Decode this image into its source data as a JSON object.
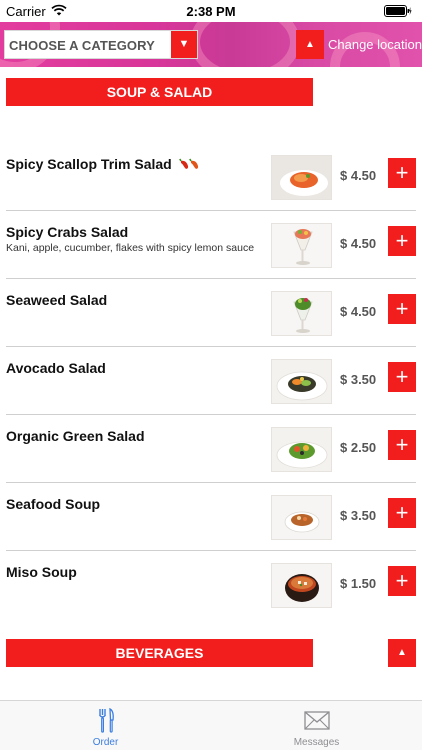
{
  "status_bar": {
    "carrier": "Carrier",
    "time": "2:38 PM",
    "icons": [
      "wifi-icon",
      "battery-icon"
    ]
  },
  "header": {
    "category_select": {
      "selected": "CHOOSE A CATEGORY",
      "arrow": "▼"
    },
    "location_button": {
      "arrow": "▲",
      "label": "Change location"
    },
    "background_color": "#d9369a"
  },
  "sections": [
    {
      "title": "SOUP & SALAD",
      "collapse_icon": ""
    },
    {
      "title": "BEVERAGES",
      "collapse_icon": "▲"
    }
  ],
  "menu_items": [
    {
      "name": "Spicy Scallop Trim Salad",
      "description": "",
      "price": "$ 4.50",
      "add": "+",
      "spicy": true,
      "thumb": "thumb-scallop-salad"
    },
    {
      "name": "Spicy Crabs Salad",
      "description": "Kani, apple, cucumber, flakes with spicy lemon sauce",
      "price": "$ 4.50",
      "add": "+",
      "spicy": false,
      "thumb": "thumb-crab-salad"
    },
    {
      "name": "Seaweed Salad",
      "description": "",
      "price": "$ 4.50",
      "add": "+",
      "spicy": false,
      "thumb": "thumb-seaweed-salad"
    },
    {
      "name": "Avocado Salad",
      "description": "",
      "price": "$ 3.50",
      "add": "+",
      "spicy": false,
      "thumb": "thumb-avocado-salad"
    },
    {
      "name": "Organic Green Salad",
      "description": "",
      "price": "$ 2.50",
      "add": "+",
      "spicy": false,
      "thumb": "thumb-green-salad"
    },
    {
      "name": "Seafood Soup",
      "description": "",
      "price": "$ 3.50",
      "add": "+",
      "spicy": false,
      "thumb": "thumb-seafood-soup"
    },
    {
      "name": "Miso Soup",
      "description": "",
      "price": "$ 1.50",
      "add": "+",
      "spicy": false,
      "thumb": "thumb-miso-soup"
    }
  ],
  "tab_bar": {
    "tabs": [
      {
        "label": "Order",
        "icon": "fork-knife-icon",
        "active": true
      },
      {
        "label": "Messages",
        "icon": "envelope-icon",
        "active": false
      }
    ]
  },
  "colors": {
    "accent_red": "#f21d1d",
    "header_pink": "#d9369a",
    "active_tab": "#3c7ee0",
    "inactive_tab": "#8e8e93"
  }
}
